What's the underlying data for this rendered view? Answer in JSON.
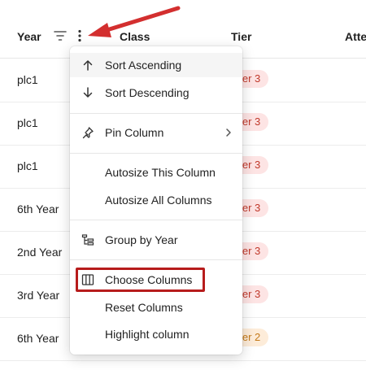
{
  "header": {
    "year": "Year",
    "class": "Class",
    "tier": "Tier",
    "attendance": "Atter"
  },
  "rows": [
    {
      "year": "plc1",
      "tier": "ier 3"
    },
    {
      "year": "plc1",
      "tier": "ier 3"
    },
    {
      "year": "plc1",
      "tier": "ier 3"
    },
    {
      "year": "6th Year",
      "tier": "ier 3"
    },
    {
      "year": "2nd Year",
      "tier": "ier 3"
    },
    {
      "year": "3rd Year",
      "tier": "ier 3"
    },
    {
      "year": "6th Year",
      "tier": "ier 2"
    }
  ],
  "menu": {
    "sort_ascending": "Sort Ascending",
    "sort_descending": "Sort Descending",
    "pin_column": "Pin Column",
    "autosize_this": "Autosize This Column",
    "autosize_all": "Autosize All Columns",
    "group_by": "Group by Year",
    "choose_columns": "Choose Columns",
    "reset_columns": "Reset Columns",
    "highlight_column": "Highlight column"
  },
  "colors": {
    "annotation": "#d32f2f",
    "badge_tier3_bg": "#fde4e4",
    "badge_tier2_bg": "#fdecd9"
  }
}
